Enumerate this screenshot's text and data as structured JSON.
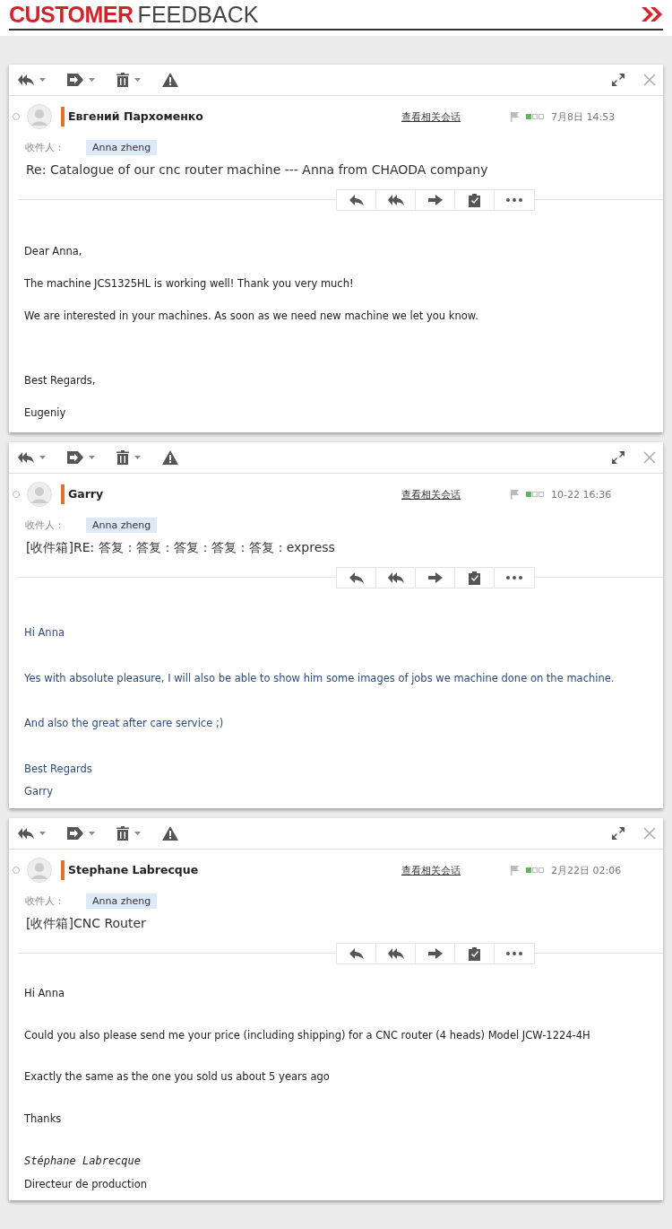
{
  "header": {
    "title_strong": "CUSTOMER",
    "title_light": "FEEDBACK"
  },
  "emails": [
    {
      "sender": "Евгений Пархоменко",
      "link": "查看相关会话",
      "date": "7月8日 14:53",
      "recipient_label": "收件人：",
      "recipient": "Anna zheng",
      "subject": "Re: Catalogue of our cnc router machine --- Anna from CHAODA company",
      "color": "#222222",
      "selected": false,
      "body": [
        {
          "kind": "text",
          "text": "Dear Anna,"
        },
        {
          "kind": "text",
          "text": "The machine JCS1325HL is working well! Thank you very much!"
        },
        {
          "kind": "text",
          "text": "We are interested in your machines. As soon as we need new machine we let you know."
        },
        {
          "kind": "text",
          "text": "Best Regards,"
        },
        {
          "kind": "text",
          "text": "Eugeniy"
        }
      ]
    },
    {
      "sender": "Garry",
      "link": "查看相关会话",
      "date": "10-22 16:36",
      "recipient_label": "收件人：",
      "recipient": "Anna zheng",
      "subject": "[收件箱]RE: 答复：答复：答复：答复：答复：express",
      "color": "#2b4c7e",
      "selected": false,
      "body": [
        {
          "kind": "text",
          "text": "Hi Anna"
        },
        {
          "kind": "text",
          "text": "Yes with absolute pleasure, I will also be able to show him some images of jobs we machine done on the machine."
        },
        {
          "kind": "text",
          "text": "And also the great after care service ;)"
        },
        {
          "kind": "text",
          "text": "Best Regards"
        },
        {
          "kind": "text",
          "text": "Garry"
        }
      ]
    },
    {
      "sender": "Stephane Labrecque",
      "link": "查看相关会话",
      "date": "2月22日 02:06",
      "recipient_label": "收件人：",
      "recipient": "Anna zheng",
      "subject": "[收件箱]CNC Router",
      "color": "#222222",
      "selected": false,
      "body": [
        {
          "kind": "text",
          "text": "Hi Anna"
        },
        {
          "kind": "text",
          "text": "Could you also please send me your price (including shipping) for a CNC router (4 heads) Model JCW-1224-4H"
        },
        {
          "kind": "text",
          "text": "Exactly the same as the one you sold us about 5 years ago"
        },
        {
          "kind": "text",
          "text": "Thanks"
        },
        {
          "kind": "signature",
          "text": "Stéphane Labrecque"
        },
        {
          "kind": "text",
          "text": "Directeur de production"
        }
      ]
    }
  ]
}
